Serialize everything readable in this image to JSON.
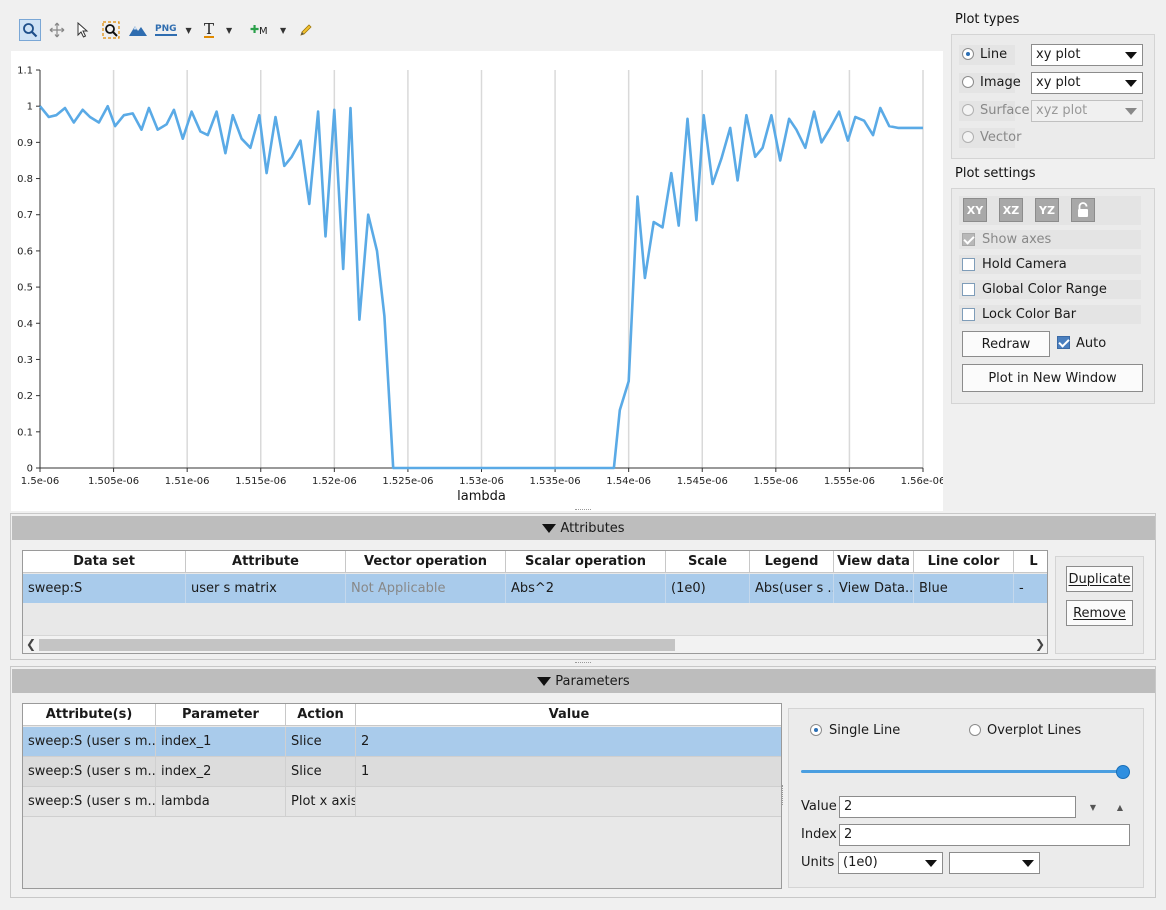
{
  "toolbar": {
    "zoom_icon": "zoom-icon",
    "pan_icon": "pan-icon",
    "select_icon": "select-icon",
    "zoom_region_icon": "zoom-region-icon",
    "mountain_icon": "mountain-icon",
    "png_label": "PNG",
    "text_label": "T",
    "marker_label": "M",
    "pencil_icon": "pencil-icon"
  },
  "chart_data": {
    "type": "line",
    "xlabel": "lambda",
    "ylabel": "",
    "title": "",
    "xlim": [
      1.5e-06,
      1.56e-06
    ],
    "ylim": [
      0,
      1.1
    ],
    "x_ticks": [
      "1.5e-06",
      "1.505e-06",
      "1.51e-06",
      "1.515e-06",
      "1.52e-06",
      "1.525e-06",
      "1.53e-06",
      "1.535e-06",
      "1.54e-06",
      "1.545e-06",
      "1.55e-06",
      "1.555e-06",
      "1.56e-06"
    ],
    "y_ticks": [
      "0",
      "0.1",
      "0.2",
      "0.3",
      "0.4",
      "0.5",
      "0.6",
      "0.7",
      "0.8",
      "0.9",
      "1",
      "1.1"
    ],
    "grid": true,
    "color": "#5aaae6",
    "series": [
      {
        "x": [
          1.5e-06,
          1.5006e-06,
          1.5011e-06,
          1.5017e-06,
          1.5023e-06,
          1.5029e-06,
          1.5034e-06,
          1.504e-06,
          1.5046e-06,
          1.5051e-06,
          1.5057e-06,
          1.5063e-06,
          1.5069e-06,
          1.5074e-06,
          1.508e-06,
          1.5086e-06,
          1.5091e-06,
          1.5097e-06,
          1.5103e-06,
          1.5109e-06,
          1.5114e-06,
          1.512e-06,
          1.5126e-06,
          1.5131e-06,
          1.5137e-06,
          1.5143e-06,
          1.5149e-06,
          1.5154e-06,
          1.516e-06,
          1.5166e-06,
          1.5171e-06,
          1.5177e-06,
          1.5183e-06,
          1.5189e-06,
          1.5194e-06,
          1.52e-06,
          1.5206e-06,
          1.5211e-06,
          1.5217e-06,
          1.5223e-06,
          1.5229e-06,
          1.5234e-06,
          1.524e-06,
          1.5246e-06,
          1.5251e-06,
          1.5257e-06,
          1.5263e-06,
          1.539e-06,
          1.5394e-06,
          1.54e-06,
          1.5406e-06,
          1.5411e-06,
          1.5417e-06,
          1.5423e-06,
          1.5429e-06,
          1.5434e-06,
          1.544e-06,
          1.5446e-06,
          1.5451e-06,
          1.5457e-06,
          1.5463e-06,
          1.5469e-06,
          1.5474e-06,
          1.548e-06,
          1.5486e-06,
          1.5491e-06,
          1.5497e-06,
          1.5503e-06,
          1.5509e-06,
          1.5514e-06,
          1.552e-06,
          1.5526e-06,
          1.5531e-06,
          1.5537e-06,
          1.5543e-06,
          1.5549e-06,
          1.5554e-06,
          1.556e-06,
          1.5566e-06,
          1.5571e-06,
          1.5577e-06,
          1.5583e-06,
          1.5589e-06,
          1.5594e-06,
          1.56e-06
        ],
        "y": [
          1.0,
          0.97,
          0.975,
          0.995,
          0.955,
          0.99,
          0.97,
          0.955,
          1.0,
          0.945,
          0.975,
          0.98,
          0.935,
          0.995,
          0.935,
          0.95,
          0.99,
          0.91,
          0.985,
          0.93,
          0.92,
          0.985,
          0.87,
          0.975,
          0.91,
          0.885,
          0.975,
          0.815,
          0.97,
          0.835,
          0.86,
          0.905,
          0.73,
          0.985,
          0.64,
          0.99,
          0.55,
          0.995,
          0.41,
          0.7,
          0.6,
          0.42,
          0.0,
          0.0,
          0.0,
          0.0,
          0.0,
          0.0,
          0.16,
          0.24,
          0.75,
          0.525,
          0.68,
          0.665,
          0.815,
          0.67,
          0.965,
          0.685,
          0.975,
          0.785,
          0.855,
          0.94,
          0.795,
          0.975,
          0.86,
          0.885,
          0.975,
          0.85,
          0.965,
          0.935,
          0.885,
          0.985,
          0.9,
          0.94,
          0.985,
          0.905,
          0.97,
          0.96,
          0.92,
          0.995,
          0.945,
          0.94,
          0.94,
          0.94,
          0.94
        ]
      }
    ]
  },
  "plot_types": {
    "title": "Plot types",
    "rows": [
      {
        "label": "Line",
        "value": "xy plot",
        "checked": true,
        "disabled": false
      },
      {
        "label": "Image",
        "value": "xy plot",
        "checked": false,
        "disabled": false
      },
      {
        "label": "Surface",
        "value": "xyz plot",
        "checked": false,
        "disabled": true
      },
      {
        "label": "Vector",
        "value": "",
        "checked": false,
        "disabled": true
      }
    ]
  },
  "plot_settings": {
    "title": "Plot settings",
    "axis_buttons": [
      "XY",
      "XZ",
      "YZ"
    ],
    "lock_icon": "lock-icon",
    "show_axes": "Show axes",
    "hold_camera": "Hold Camera",
    "global_color_range": "Global Color Range",
    "lock_color_bar": "Lock Color Bar",
    "redraw": "Redraw",
    "auto": "Auto",
    "plot_new_window": "Plot in New Window"
  },
  "attributes": {
    "header": "Attributes",
    "columns": [
      "Data set",
      "Attribute",
      "Vector operation",
      "Scalar operation",
      "Scale",
      "Legend",
      "View data",
      "Line color",
      "L"
    ],
    "row": [
      "sweep:S",
      "user s matrix",
      "Not Applicable",
      "Abs^2",
      "(1e0)",
      "Abs(user s ...",
      "View Data...",
      "Blue",
      "-"
    ],
    "duplicate": "Duplicate",
    "remove": "Remove"
  },
  "parameters": {
    "header": "Parameters",
    "columns": [
      "Attribute(s)",
      "Parameter",
      "Action",
      "Value"
    ],
    "rows": [
      [
        "sweep:S (user s m...",
        "index_1",
        "Slice",
        "2"
      ],
      [
        "sweep:S (user s m...",
        "index_2",
        "Slice",
        "1"
      ],
      [
        "sweep:S (user s m...",
        "lambda",
        "Plot x axis",
        ""
      ]
    ],
    "single_line": "Single Line",
    "overplot_lines": "Overplot Lines",
    "slider_fraction": 1.0,
    "value_label": "Value",
    "value": "2",
    "index_label": "Index",
    "index": "2",
    "units_label": "Units",
    "units_value": "(1e0)",
    "units_value2": ""
  }
}
